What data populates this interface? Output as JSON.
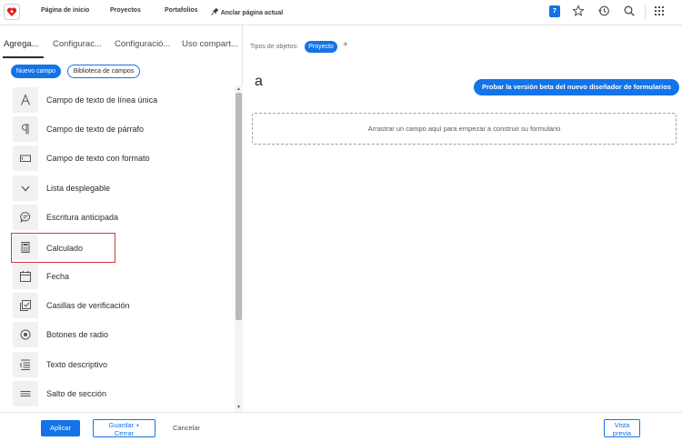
{
  "header": {
    "nav": [
      {
        "label": "Página de inicio"
      },
      {
        "label": "Proyectos"
      },
      {
        "label": "Portafolios"
      },
      {
        "label": "Anclar página actual"
      }
    ],
    "notification_count": "7",
    "icons": [
      "logo-icon",
      "pin-icon",
      "star-icon",
      "history-icon",
      "search-icon",
      "apps-grid-icon"
    ]
  },
  "left_panel": {
    "tabs": [
      {
        "label": "Agrega..."
      },
      {
        "label": "Configurac..."
      },
      {
        "label": "Configuració..."
      },
      {
        "label": "Uso compart..."
      }
    ],
    "active_tab": 0,
    "new_field_button": "Nuevo campo",
    "field_library_button": "Biblioteca de campos",
    "fields": [
      {
        "label": "Campo de texto de línea única",
        "icon": "text-a-icon"
      },
      {
        "label": "Campo de texto de párrafo",
        "icon": "pilcrow-icon"
      },
      {
        "label": "Campo de texto con formato",
        "icon": "rich-text-icon"
      },
      {
        "label": "Lista desplegable",
        "icon": "chevron-down-icon"
      },
      {
        "label": "Escritura anticipada",
        "icon": "typeahead-icon"
      },
      {
        "label": "Calculado",
        "icon": "calculator-icon",
        "highlighted": true
      },
      {
        "label": "Fecha",
        "icon": "calendar-icon"
      },
      {
        "label": "Casillas de verificación",
        "icon": "checkbox-icon"
      },
      {
        "label": "Botones de radio",
        "icon": "radio-icon"
      },
      {
        "label": "Texto descriptivo",
        "icon": "descriptive-text-icon"
      },
      {
        "label": "Salto de sección",
        "icon": "section-break-icon"
      }
    ]
  },
  "right_panel": {
    "object_types_label": "Tipos de objetos:",
    "object_type": "Proyecto",
    "add_symbol": "+",
    "form_title": "a",
    "beta_button": "Probar la versión beta del nuevo diseñador de formularios",
    "dropzone_text": "Arrastrar un campo aquí para empezar a construir su formulario"
  },
  "footer": {
    "apply": "Aplicar",
    "save_close_line1": "Guardar +",
    "save_close_line2": "Cerrar",
    "cancel": "Cancelar",
    "preview_line1": "Vista",
    "preview_line2": "previa"
  },
  "colors": {
    "accent": "#1473e6",
    "highlight_border": "#d7373f",
    "logo": "#e0201b"
  }
}
